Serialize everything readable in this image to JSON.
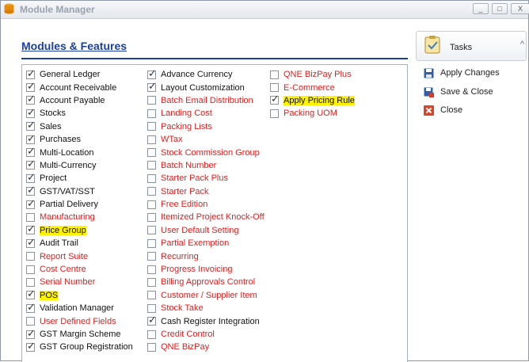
{
  "window": {
    "title": "Module Manager",
    "min_glyph": "_",
    "max_glyph": "□",
    "close_glyph": "X"
  },
  "main": {
    "heading": "Modules & Features"
  },
  "columns": [
    [
      {
        "label": "General Ledger",
        "checked": true,
        "highlight": false
      },
      {
        "label": "Account Receivable",
        "checked": true,
        "highlight": false
      },
      {
        "label": "Account Payable",
        "checked": true,
        "highlight": false
      },
      {
        "label": "Stocks",
        "checked": true,
        "highlight": false
      },
      {
        "label": "Sales",
        "checked": true,
        "highlight": false
      },
      {
        "label": "Purchases",
        "checked": true,
        "highlight": false
      },
      {
        "label": "Multi-Location",
        "checked": true,
        "highlight": false
      },
      {
        "label": "Multi-Currency",
        "checked": true,
        "highlight": false
      },
      {
        "label": "Project",
        "checked": true,
        "highlight": false
      },
      {
        "label": "GST/VAT/SST",
        "checked": true,
        "highlight": false
      },
      {
        "label": "Partial Delivery",
        "checked": true,
        "highlight": false
      },
      {
        "label": "Manufacturing",
        "checked": false,
        "highlight": false
      },
      {
        "label": "Price Group",
        "checked": true,
        "highlight": true
      },
      {
        "label": "Audit Trail",
        "checked": true,
        "highlight": false
      },
      {
        "label": "Report Suite",
        "checked": false,
        "highlight": false
      },
      {
        "label": "Cost Centre",
        "checked": false,
        "highlight": false
      },
      {
        "label": "Serial Number",
        "checked": false,
        "highlight": false
      },
      {
        "label": "POS",
        "checked": true,
        "highlight": true
      },
      {
        "label": "Validation Manager",
        "checked": true,
        "highlight": false
      },
      {
        "label": "User Defined Fields",
        "checked": false,
        "highlight": false
      },
      {
        "label": "GST Margin Scheme",
        "checked": true,
        "highlight": false
      },
      {
        "label": "GST Group Registration",
        "checked": true,
        "highlight": false
      }
    ],
    [
      {
        "label": "Advance Currency",
        "checked": true,
        "highlight": false
      },
      {
        "label": "Layout Customization",
        "checked": true,
        "highlight": false
      },
      {
        "label": "Batch Email Distribution",
        "checked": false,
        "highlight": false
      },
      {
        "label": "Landing Cost",
        "checked": false,
        "highlight": false
      },
      {
        "label": "Packing Lists",
        "checked": false,
        "highlight": false
      },
      {
        "label": "WTax",
        "checked": false,
        "highlight": false
      },
      {
        "label": "Stock Commission Group",
        "checked": false,
        "highlight": false
      },
      {
        "label": "Batch Number",
        "checked": false,
        "highlight": false
      },
      {
        "label": "Starter Pack Plus",
        "checked": false,
        "highlight": false
      },
      {
        "label": "Starter Pack",
        "checked": false,
        "highlight": false
      },
      {
        "label": "Free Edition",
        "checked": false,
        "highlight": false
      },
      {
        "label": "Itemized Project Knock-Off",
        "checked": false,
        "highlight": false
      },
      {
        "label": "User Default Setting",
        "checked": false,
        "highlight": false
      },
      {
        "label": "Partial Exemption",
        "checked": false,
        "highlight": false
      },
      {
        "label": "Recurring",
        "checked": false,
        "highlight": false
      },
      {
        "label": "Progress Invoicing",
        "checked": false,
        "highlight": false
      },
      {
        "label": "Billing Approvals Control",
        "checked": false,
        "highlight": false
      },
      {
        "label": "Customer / Supplier Item",
        "checked": false,
        "highlight": false
      },
      {
        "label": "Stock Take",
        "checked": false,
        "highlight": false
      },
      {
        "label": "Cash Register Integration",
        "checked": true,
        "highlight": false
      },
      {
        "label": "Credit Control",
        "checked": false,
        "highlight": false
      },
      {
        "label": "QNE BizPay",
        "checked": false,
        "highlight": false
      }
    ],
    [
      {
        "label": "QNE BizPay Plus",
        "checked": false,
        "highlight": false
      },
      {
        "label": "E-Commerce",
        "checked": false,
        "highlight": false
      },
      {
        "label": "Apply Pricing Rule",
        "checked": true,
        "highlight": true
      },
      {
        "label": "Packing UOM",
        "checked": false,
        "highlight": false
      }
    ]
  ],
  "side": {
    "tasks_label": "Tasks",
    "chevron": "^",
    "actions": [
      {
        "label": "Apply Changes",
        "icon": "floppy-disk-icon"
      },
      {
        "label": "Save & Close",
        "icon": "save-close-icon"
      },
      {
        "label": "Close",
        "icon": "close-x-icon"
      }
    ]
  },
  "colors": {
    "heading": "#1b3f9e",
    "unchecked_text": "#e02020",
    "checked_text": "#111111",
    "highlight": "#fff200"
  }
}
